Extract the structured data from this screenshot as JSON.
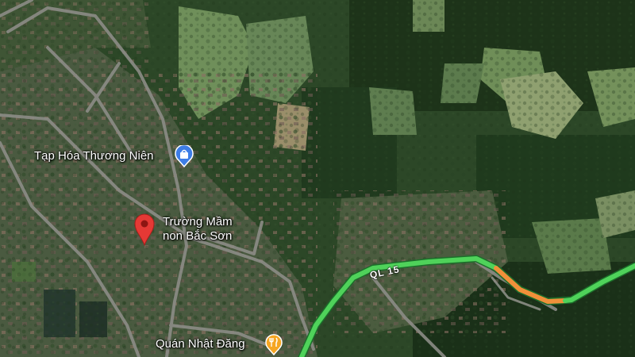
{
  "map": {
    "type": "satellite",
    "road_colors": {
      "fast": "#4fd25a",
      "slow": "#f0903a",
      "casing": "#1c6e2a"
    }
  },
  "pois": [
    {
      "label": "Tạp Hóa Thương Niên",
      "icon": "shopping-bag-icon",
      "color": "#3d7de6"
    },
    {
      "label_line1": "Trường Mầm",
      "label_line2": "non Bắc Sơn",
      "icon": "location-pin-icon",
      "color": "#e53935"
    },
    {
      "label": "Quán Nhật Đăng",
      "icon": "restaurant-icon",
      "color": "#f5a623"
    }
  ],
  "roads": [
    {
      "label": "QL 15"
    }
  ]
}
